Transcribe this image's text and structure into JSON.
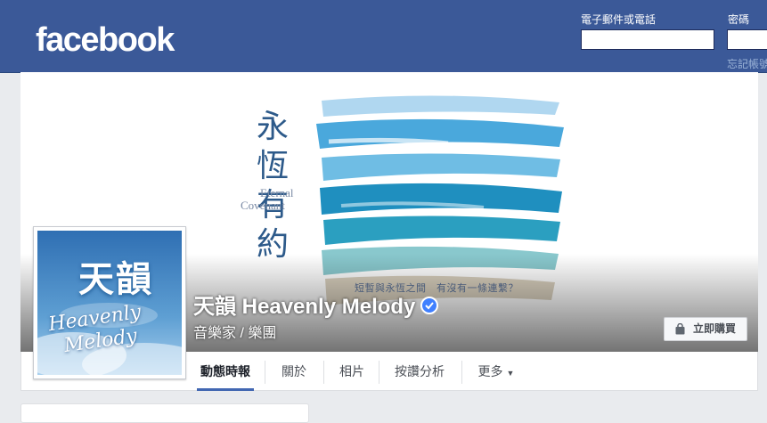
{
  "header": {
    "logo": "facebook",
    "email_label": "電子郵件或電話",
    "password_label": "密碼",
    "email_value": "",
    "password_value": "",
    "forgot_link": "忘記帳號？"
  },
  "cover": {
    "vertical_text": "永恆有約",
    "english_line1": "Eternal",
    "english_line2": "Covenant",
    "caption": "短暫與永恆之間　有沒有一條連繫？"
  },
  "profile": {
    "avatar_title": "天韻",
    "avatar_script": "Heavenly\n  Melody",
    "name": "天韻 Heavenly Melody",
    "category": "音樂家 / 樂團",
    "buy_button": "立即購買"
  },
  "tabs": [
    {
      "label": "動態時報"
    },
    {
      "label": "關於"
    },
    {
      "label": "相片"
    },
    {
      "label": "按讚分析"
    },
    {
      "label": "更多"
    }
  ],
  "colors": {
    "brand_blue": "#3b5998",
    "tab_underline": "#4267b2",
    "verified_blue": "#4080ff"
  },
  "icons": [
    "verified-badge-icon",
    "shopping-bag-icon",
    "caret-down-icon"
  ]
}
